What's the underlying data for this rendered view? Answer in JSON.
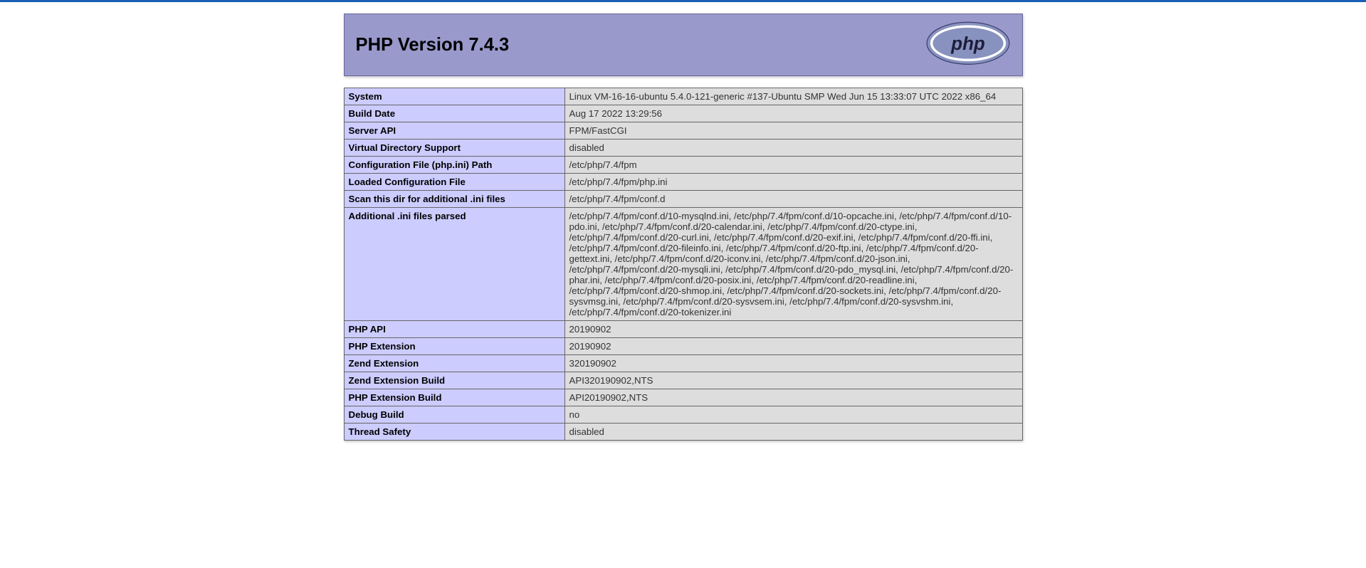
{
  "header": {
    "title": "PHP Version 7.4.3"
  },
  "table": {
    "rows": [
      {
        "label": "System",
        "value": "Linux VM-16-16-ubuntu 5.4.0-121-generic #137-Ubuntu SMP Wed Jun 15 13:33:07 UTC 2022 x86_64"
      },
      {
        "label": "Build Date",
        "value": "Aug 17 2022 13:29:56"
      },
      {
        "label": "Server API",
        "value": "FPM/FastCGI"
      },
      {
        "label": "Virtual Directory Support",
        "value": "disabled"
      },
      {
        "label": "Configuration File (php.ini) Path",
        "value": "/etc/php/7.4/fpm"
      },
      {
        "label": "Loaded Configuration File",
        "value": "/etc/php/7.4/fpm/php.ini"
      },
      {
        "label": "Scan this dir for additional .ini files",
        "value": "/etc/php/7.4/fpm/conf.d"
      },
      {
        "label": "Additional .ini files parsed",
        "value": "/etc/php/7.4/fpm/conf.d/10-mysqlnd.ini, /etc/php/7.4/fpm/conf.d/10-opcache.ini, /etc/php/7.4/fpm/conf.d/10-pdo.ini, /etc/php/7.4/fpm/conf.d/20-calendar.ini, /etc/php/7.4/fpm/conf.d/20-ctype.ini, /etc/php/7.4/fpm/conf.d/20-curl.ini, /etc/php/7.4/fpm/conf.d/20-exif.ini, /etc/php/7.4/fpm/conf.d/20-ffi.ini, /etc/php/7.4/fpm/conf.d/20-fileinfo.ini, /etc/php/7.4/fpm/conf.d/20-ftp.ini, /etc/php/7.4/fpm/conf.d/20-gettext.ini, /etc/php/7.4/fpm/conf.d/20-iconv.ini, /etc/php/7.4/fpm/conf.d/20-json.ini, /etc/php/7.4/fpm/conf.d/20-mysqli.ini, /etc/php/7.4/fpm/conf.d/20-pdo_mysql.ini, /etc/php/7.4/fpm/conf.d/20-phar.ini, /etc/php/7.4/fpm/conf.d/20-posix.ini, /etc/php/7.4/fpm/conf.d/20-readline.ini, /etc/php/7.4/fpm/conf.d/20-shmop.ini, /etc/php/7.4/fpm/conf.d/20-sockets.ini, /etc/php/7.4/fpm/conf.d/20-sysvmsg.ini, /etc/php/7.4/fpm/conf.d/20-sysvsem.ini, /etc/php/7.4/fpm/conf.d/20-sysvshm.ini, /etc/php/7.4/fpm/conf.d/20-tokenizer.ini"
      },
      {
        "label": "PHP API",
        "value": "20190902"
      },
      {
        "label": "PHP Extension",
        "value": "20190902"
      },
      {
        "label": "Zend Extension",
        "value": "320190902"
      },
      {
        "label": "Zend Extension Build",
        "value": "API320190902,NTS"
      },
      {
        "label": "PHP Extension Build",
        "value": "API20190902,NTS"
      },
      {
        "label": "Debug Build",
        "value": "no"
      },
      {
        "label": "Thread Safety",
        "value": "disabled"
      }
    ]
  }
}
